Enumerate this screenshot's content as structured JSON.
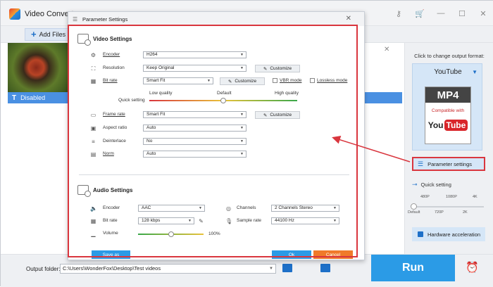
{
  "app": {
    "title": "Video Converte",
    "add_files": "Add Files"
  },
  "file": {
    "disabled_label": "Disabled"
  },
  "right_panel": {
    "caption": "Click to change output format:",
    "format_name": "YouTube",
    "format_box_top": "MP4",
    "format_box_compat": "Compatible with",
    "format_box_logo_a": "You",
    "format_box_logo_b": "Tube",
    "param_settings": "Parameter settings",
    "quick_setting": "Quick setting",
    "qs_ticks_top": [
      "480P",
      "1080P",
      "4K"
    ],
    "qs_ticks_bottom": [
      "Default",
      "720P",
      "2K"
    ],
    "qs_level": 0.0,
    "hw_accel": "Hardware acceleration"
  },
  "footer": {
    "output_label": "Output folder:",
    "output_path": "C:\\Users\\WonderFox\\Desktop\\Test videos",
    "run": "Run"
  },
  "dialog": {
    "title": "Parameter Settings",
    "video": {
      "heading": "Video Settings",
      "encoder_label": "Encoder",
      "encoder_value": "H264",
      "resolution_label": "Resolution",
      "resolution_value": "Keep Original",
      "customize": "Customize",
      "bitrate_label": "Bit rate",
      "bitrate_value": "Smart Fit",
      "vbr_mode": "VBR mode",
      "lossless_mode": "Lossless mode",
      "low_quality": "Low quality",
      "default": "Default",
      "high_quality": "High quality",
      "quick_setting": "Quick setting",
      "quality_level": 0.5,
      "framerate_label": "Frame rate",
      "framerate_value": "Smart Fit",
      "aspect_label": "Aspect ratio",
      "aspect_value": "Auto",
      "deinterlace_label": "Deinterlace",
      "deinterlace_value": "No",
      "norm_label": "Norm",
      "norm_value": "Auto"
    },
    "audio": {
      "heading": "Audio Settings",
      "encoder_label": "Encoder",
      "encoder_value": "AAC",
      "channels_label": "Channels",
      "channels_value": "2 Channels Stereo",
      "bitrate_label": "Bit rate",
      "bitrate_value": "128 kbps",
      "samplerate_label": "Sample rate",
      "samplerate_value": "44100 Hz",
      "volume_label": "Volume",
      "volume_value": "100%",
      "volume_level": 0.5
    },
    "save_as": "Save as",
    "ok": "Ok",
    "cancel": "Cancel"
  },
  "colors": {
    "accent": "#2b9be6",
    "highlight": "#d9363e",
    "cancel": "#f07a2a"
  }
}
